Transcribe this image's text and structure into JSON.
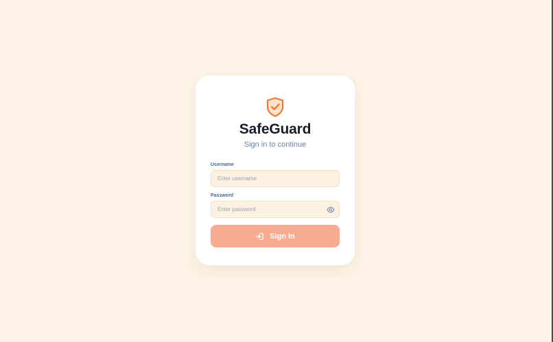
{
  "brand": {
    "title": "SafeGuard",
    "subtitle": "Sign in to continue",
    "logo_icon": "shield-check-icon",
    "accent_color": "#f07a2e"
  },
  "form": {
    "username": {
      "label": "Username",
      "placeholder": "Enter username",
      "value": ""
    },
    "password": {
      "label": "Password",
      "placeholder": "Enter password",
      "value": "",
      "toggle_icon": "eye-icon"
    },
    "submit": {
      "label": "Sign In",
      "icon": "login-icon",
      "color": "#f8ab91"
    }
  },
  "theme": {
    "page_background": "#fdf4e7",
    "card_background": "#ffffff",
    "field_background": "#fdf1e1"
  }
}
